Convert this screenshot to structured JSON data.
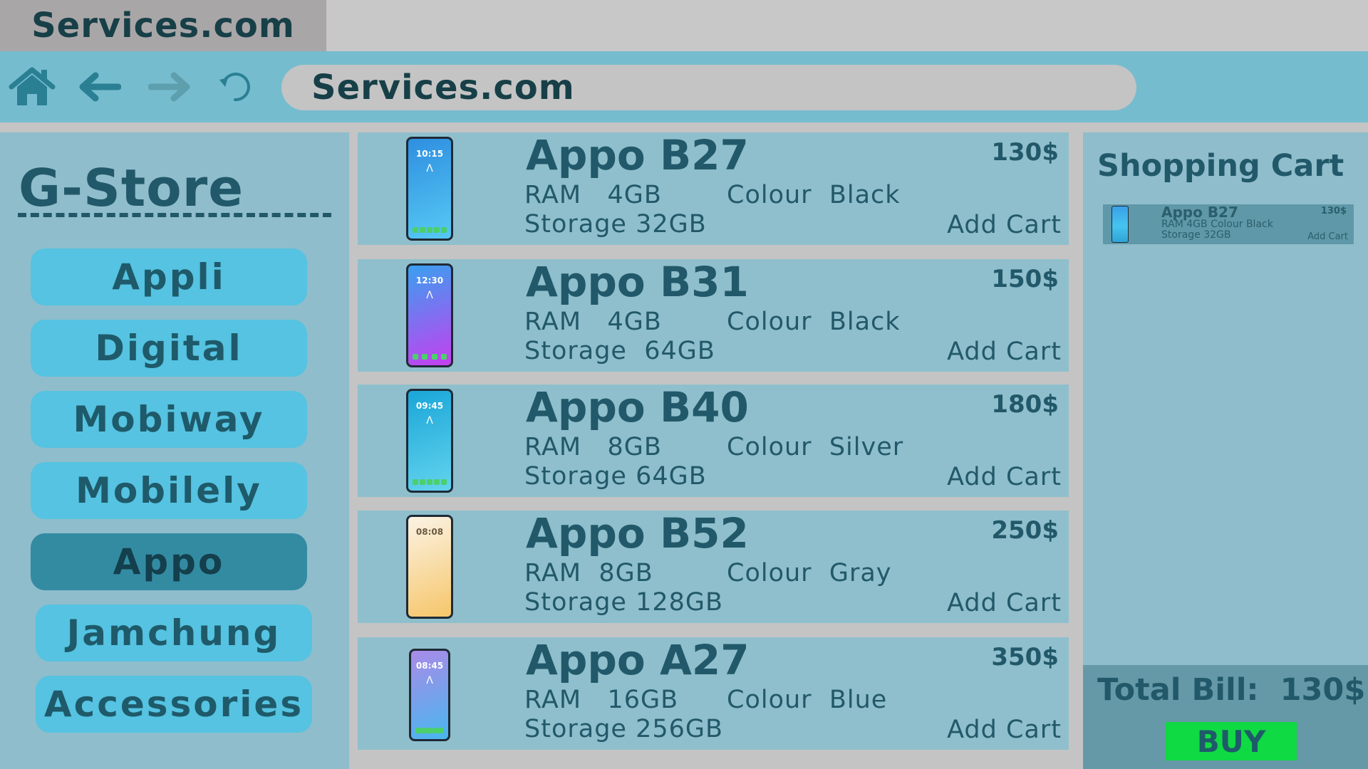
{
  "browser": {
    "tab_title": "Services.com",
    "address": "Services.com",
    "nav_icons": [
      "home-icon",
      "back-arrow-icon",
      "forward-arrow-icon",
      "reload-icon"
    ]
  },
  "sidebar": {
    "brand": "G-Store",
    "categories": [
      {
        "label": "Appli",
        "active": false
      },
      {
        "label": "Digital",
        "active": false
      },
      {
        "label": "Mobiway",
        "active": false
      },
      {
        "label": "Mobilely",
        "active": false
      },
      {
        "label": "Appo",
        "active": true
      },
      {
        "label": "Jamchung",
        "active": false
      },
      {
        "label": "Accessories",
        "active": false
      }
    ]
  },
  "products": [
    {
      "name": "Appo B27",
      "ram_label": "RAM",
      "ram": "4GB",
      "colour_label": "Colour",
      "colour": "Black",
      "storage_label": "Storage",
      "storage": "32GB",
      "price": "130$",
      "add_label": "Add Cart",
      "screen_time": "10:15",
      "screen_colors": [
        "#2e8fe0",
        "#57c9f4"
      ]
    },
    {
      "name": "Appo B31",
      "ram_label": "RAM",
      "ram": "4GB",
      "colour_label": "Colour",
      "colour": "Black",
      "storage_label": "Storage",
      "storage": "64GB",
      "price": "150$",
      "add_label": "Add Cart",
      "screen_time": "12:30",
      "screen_colors": [
        "#39a0f0",
        "#c63ff0"
      ]
    },
    {
      "name": "Appo B40",
      "ram_label": "RAM",
      "ram": "8GB",
      "colour_label": "Colour",
      "colour": "Silver",
      "storage_label": "Storage",
      "storage": "64GB",
      "price": "180$",
      "add_label": "Add Cart",
      "screen_time": "09:45",
      "screen_colors": [
        "#1aa6d8",
        "#63d4ee"
      ]
    },
    {
      "name": "Appo B52",
      "ram_label": "RAM",
      "ram": "8GB",
      "colour_label": "Colour",
      "colour": "Gray",
      "storage_label": "Storage",
      "storage": "128GB",
      "price": "250$",
      "add_label": "Add Cart",
      "screen_time": "08:08",
      "screen_colors": [
        "#fbf3e4",
        "#f6c66a"
      ]
    },
    {
      "name": "Appo A27",
      "ram_label": "RAM",
      "ram": "16GB",
      "colour_label": "Colour",
      "colour": "Blue",
      "storage_label": "Storage",
      "storage": "256GB",
      "price": "350$",
      "add_label": "Add Cart",
      "screen_time": "08:45",
      "screen_colors": [
        "#a98be8",
        "#49b6ee"
      ]
    }
  ],
  "cart": {
    "title": "Shopping Cart",
    "items": [
      {
        "name": "Appo B27",
        "spec_line1": "RAM   4GB   Colour  Black",
        "spec_line2": "Storage 32GB",
        "price": "130$",
        "add_label": "Add Cart"
      }
    ],
    "total_label": "Total Bill:",
    "total_value": "130$",
    "buy_label": "BUY"
  },
  "colors": {
    "accent": "#55c3e1",
    "active_category": "#338ba2",
    "buy": "#0fd943",
    "text": "#22596a"
  }
}
